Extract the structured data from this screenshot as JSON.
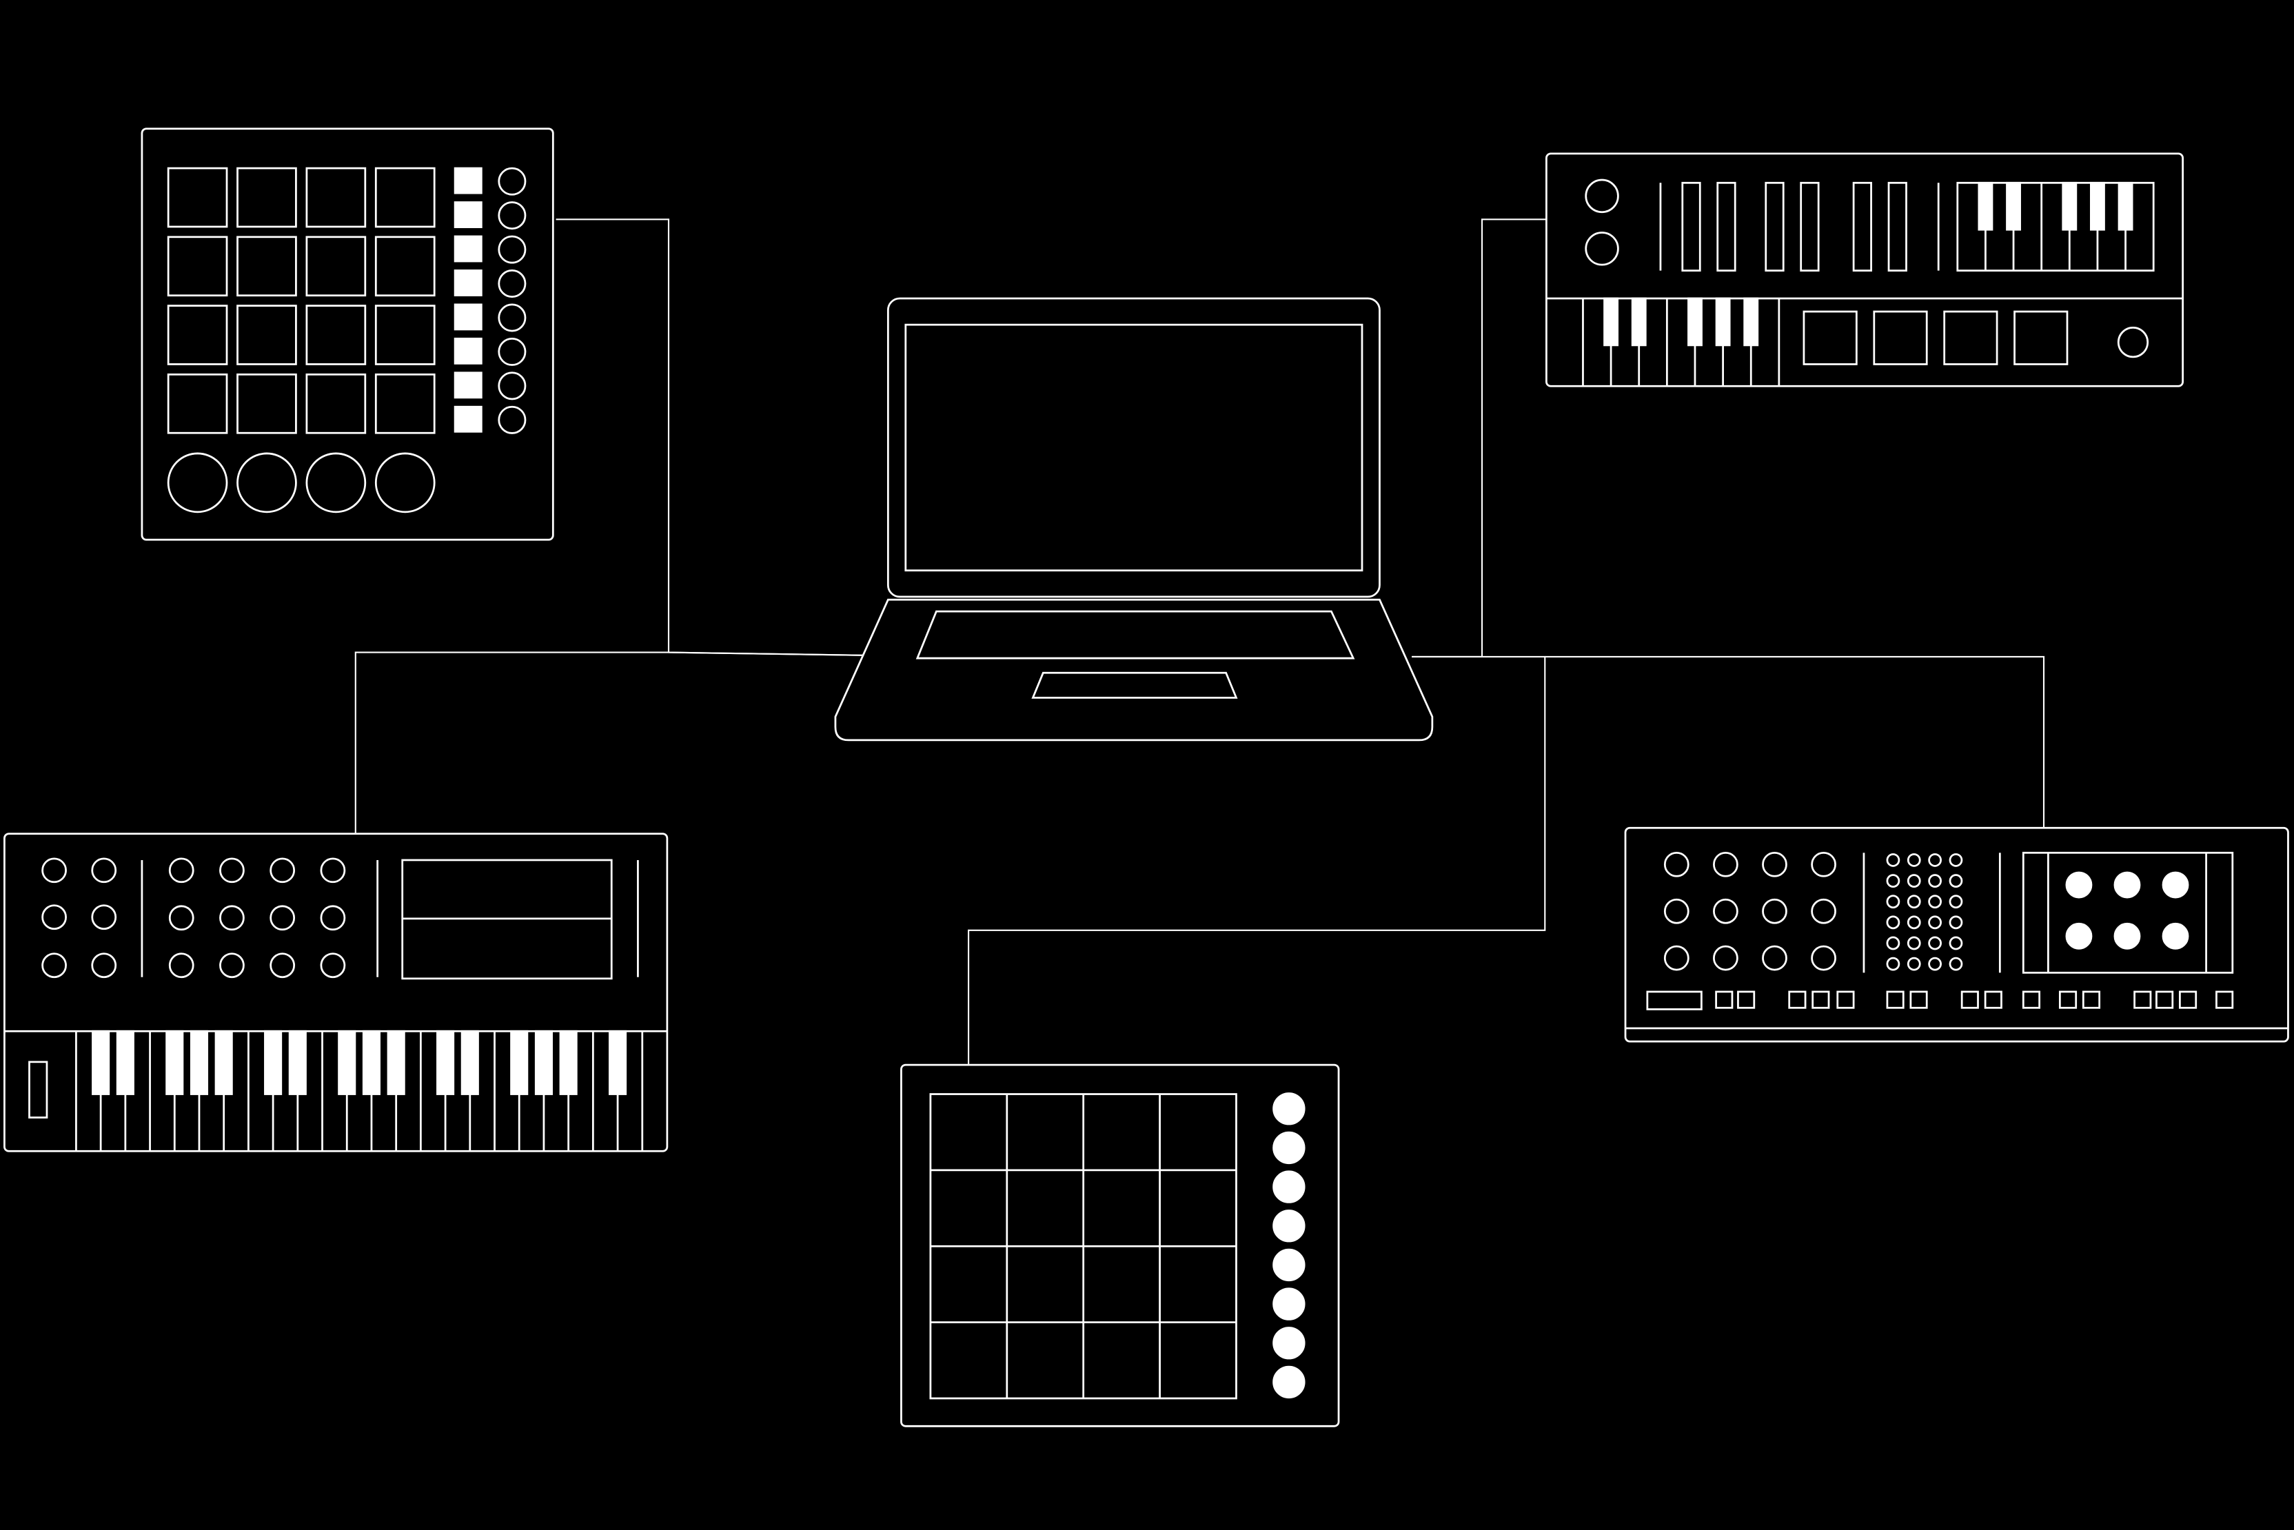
{
  "diagram": {
    "theme": {
      "background": "#000000",
      "stroke": "#ffffff",
      "fill": "#ffffff"
    },
    "hub": {
      "name": "laptop",
      "icon": "laptop-icon"
    },
    "devices": [
      {
        "name": "pad-controller",
        "icon": "pad-controller-icon"
      },
      {
        "name": "mini-synth",
        "icon": "mini-synth-icon"
      },
      {
        "name": "keyboard-controller",
        "icon": "keyboard-controller-icon"
      },
      {
        "name": "grid-controller",
        "icon": "grid-controller-icon"
      },
      {
        "name": "sequencer-module",
        "icon": "sequencer-module-icon"
      }
    ],
    "connections": [
      {
        "from": "laptop",
        "to": "pad-controller"
      },
      {
        "from": "laptop",
        "to": "keyboard-controller"
      },
      {
        "from": "laptop",
        "to": "mini-synth"
      },
      {
        "from": "laptop",
        "to": "grid-controller"
      },
      {
        "from": "laptop",
        "to": "sequencer-module"
      }
    ]
  }
}
